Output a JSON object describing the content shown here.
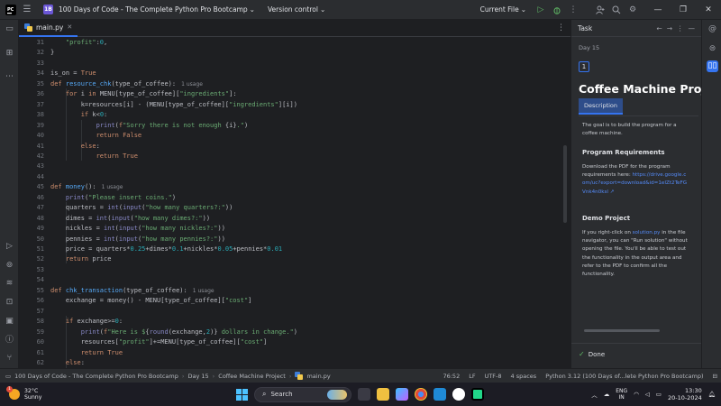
{
  "titlebar": {
    "project_badge": "1B",
    "project_name": "100 Days of Code - The Complete Python Pro Bootcamp",
    "vcs_label": "Version control",
    "run_config": "Current File"
  },
  "editor": {
    "tab_label": "main.py",
    "usage_hint": "1 usage",
    "lines": [
      {
        "n": "31",
        "code": "    <span class=\"str\">\"profit\"</span>:<span class=\"num\">0</span>,"
      },
      {
        "n": "32",
        "code": "}"
      },
      {
        "n": "33",
        "code": ""
      },
      {
        "n": "34",
        "code": "is_on = <span class=\"kw\">True</span>"
      },
      {
        "n": "35",
        "code": "<span class=\"kw\">def</span> <span class=\"fn\">resource_chk</span>(type_of_coffee):<span class=\"usage\">1 usage</span>"
      },
      {
        "n": "36",
        "code": "    <span class=\"kw\">for</span> i <span class=\"kw\">in</span> MENU[type_of_coffee][<span class=\"str\">\"ingredients\"</span>]:"
      },
      {
        "n": "37",
        "code": "        k=resources[i] - (MENU[type_of_coffee][<span class=\"str\">\"ingredients\"</span>][i])"
      },
      {
        "n": "38",
        "code": "        <span class=\"kw\">if</span> k&lt;<span class=\"num\">0</span>:"
      },
      {
        "n": "39",
        "code": "            <span class=\"bi\">print</span>(<span class=\"fs\">f</span><span class=\"str\">\"Sorry there is not enough </span>{i}<span class=\"str\">.\"</span>)"
      },
      {
        "n": "40",
        "code": "            <span class=\"kw\">return False</span>"
      },
      {
        "n": "41",
        "code": "        <span class=\"kw\">else</span>:"
      },
      {
        "n": "42",
        "code": "            <span class=\"kw\">return True</span>"
      },
      {
        "n": "43",
        "code": ""
      },
      {
        "n": "44",
        "code": ""
      },
      {
        "n": "45",
        "code": "<span class=\"kw\">def</span> <span class=\"fn\">money</span>():<span class=\"usage\">1 usage</span>"
      },
      {
        "n": "46",
        "code": "    <span class=\"bi\">print</span>(<span class=\"str\">\"Please insert coins.\"</span>)"
      },
      {
        "n": "47",
        "code": "    quarters = <span class=\"bi\">int</span>(<span class=\"bi\">input</span>(<span class=\"str\">\"how many quarters?:\"</span>))"
      },
      {
        "n": "48",
        "code": "    dimes = <span class=\"bi\">int</span>(<span class=\"bi\">input</span>(<span class=\"str\">\"how many dimes?:\"</span>))"
      },
      {
        "n": "49",
        "code": "    nickles = <span class=\"bi\">int</span>(<span class=\"bi\">input</span>(<span class=\"str\">\"how many nickles?:\"</span>))"
      },
      {
        "n": "50",
        "code": "    pennies = <span class=\"bi\">int</span>(<span class=\"bi\">input</span>(<span class=\"str\">\"how many pennies?:\"</span>))"
      },
      {
        "n": "51",
        "code": "    price = quarters*<span class=\"num\">0.25</span>+dimes*<span class=\"num\">0.1</span>+nickles*<span class=\"num\">0.05</span>+pennies*<span class=\"num\">0.01</span>"
      },
      {
        "n": "52",
        "code": "    <span class=\"kw\">return</span> price"
      },
      {
        "n": "53",
        "code": ""
      },
      {
        "n": "54",
        "code": ""
      },
      {
        "n": "55",
        "code": "<span class=\"kw\">def</span> <span class=\"fn\">chk_transaction</span>(type_of_coffee):<span class=\"usage\">1 usage</span>"
      },
      {
        "n": "56",
        "code": "    exchange = money() - MENU[type_of_coffee][<span class=\"str\">\"cost\"</span>]"
      },
      {
        "n": "57",
        "code": ""
      },
      {
        "n": "58",
        "code": "    <span class=\"kw\">if</span> exchange&gt;=<span class=\"num\">0</span>:"
      },
      {
        "n": "59",
        "code": "        <span class=\"bi\">print</span>(<span class=\"fs\">f</span><span class=\"str\">\"Here is $</span>{<span class=\"bi\">round</span>(exchange,<span class=\"num\">2</span>)}<span class=\"str\"> dollars in change.\"</span>)"
      },
      {
        "n": "60",
        "code": "        resources[<span class=\"str\">\"profit\"</span>]+=MENU[type_of_coffee][<span class=\"str\">\"cost\"</span>]"
      },
      {
        "n": "61",
        "code": "        <span class=\"kw\">return True</span>"
      },
      {
        "n": "62",
        "code": "    <span class=\"kw\">else</span>:"
      }
    ]
  },
  "task_panel": {
    "header": "Task",
    "day": "Day 15",
    "step": "1",
    "title": "Coffee Machine Projec",
    "tab": "Description",
    "intro": "The goal is to build the program for a coffee machine.",
    "req_heading": "Program Requirements",
    "req_text": "Download the PDF for the program requirements here:",
    "req_link": "https://drive.google.com/uc?export=download&id=1eIZt2TeFGVnk4n0ksl",
    "demo_heading": "Demo Project",
    "demo_text_1": "If you right-click on ",
    "demo_link": "solution.py",
    "demo_text_2": " in the file navigator, you can \"Run solution\" without opening the file. You'll be able to test out the functionality in the output area and refer to the PDF to confirm all the functionality.",
    "done_label": "Done"
  },
  "statusbar": {
    "crumb_1": "100 Days of Code - The Complete Python Pro Bootcamp",
    "crumb_2": "Day 15",
    "crumb_3": "Coffee Machine Project",
    "crumb_4": "main.py",
    "position": "76:52",
    "line_sep": "LF",
    "encoding": "UTF-8",
    "indent": "4 spaces",
    "interpreter": "Python 3.12 (100 Days of...lete Python Pro Bootcamp)"
  },
  "taskbar": {
    "weather_badge": "1",
    "temperature": "32°C",
    "condition": "Sunny",
    "search_placeholder": "Search",
    "lang_1": "ENG",
    "lang_2": "IN",
    "time": "13:30",
    "date": "20-10-2024"
  },
  "colors": {
    "accent": "#3574f0",
    "keyword": "#cf8e6d",
    "string": "#6aab73",
    "number": "#2aacb8",
    "function": "#56a8f5"
  }
}
